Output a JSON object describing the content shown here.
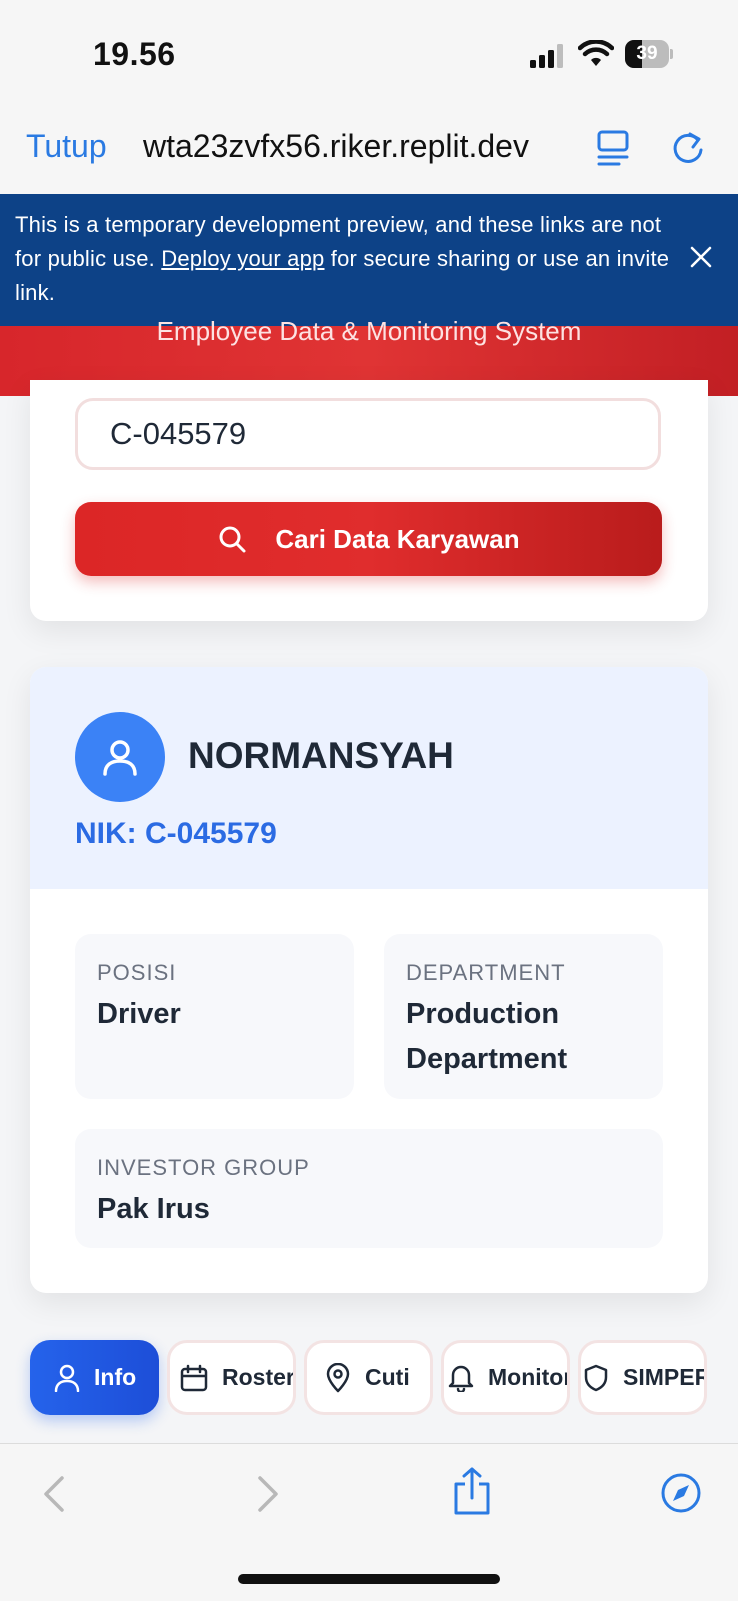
{
  "status_bar": {
    "time": "19.56",
    "battery": "39",
    "battery_level": 0.39
  },
  "browser": {
    "close_label": "Tutup",
    "url": "wta23zvfx56.riker.replit.dev"
  },
  "banner": {
    "text_before": "This is a temporary development preview, and these links are not for public use. ",
    "link_text": "Deploy your app",
    "text_after": " for secure sharing or use an invite link."
  },
  "header": {
    "subtitle": "Employee Data & Monitoring System"
  },
  "search": {
    "value": "C-045579",
    "button_label": "Cari Data Karyawan"
  },
  "employee": {
    "name": "NORMANSYAH",
    "nik": "NIK: C-045579",
    "fields": [
      {
        "label": "POSISI",
        "value": "Driver"
      },
      {
        "label": "DEPARTMENT",
        "value": "Production Department"
      },
      {
        "label": "INVESTOR GROUP",
        "value": "Pak Irus"
      }
    ]
  },
  "tabs": [
    {
      "label": "Info",
      "icon": "user-icon",
      "active": true
    },
    {
      "label": "Roster",
      "icon": "calendar-icon",
      "active": false
    },
    {
      "label": "Cuti",
      "icon": "map-pin-icon",
      "active": false
    },
    {
      "label": "Monitor",
      "icon": "bell-icon",
      "active": false
    },
    {
      "label": "SIMPER",
      "icon": "shield-icon",
      "active": false
    }
  ],
  "colors": {
    "banner_bg": "#0d4287",
    "brand_red": "#dc2626",
    "accent_blue": "#2563eb",
    "safari_blue": "#2a7ae2"
  }
}
